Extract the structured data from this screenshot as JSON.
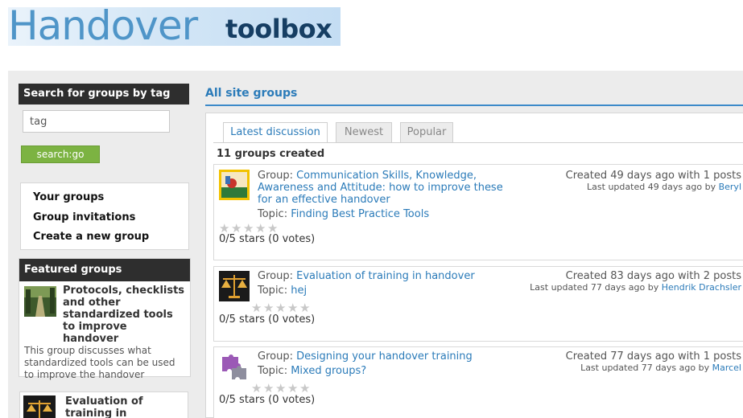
{
  "header": {
    "logo_text_1": "Handover",
    "logo_text_2": "toolbox"
  },
  "sidebar": {
    "search": {
      "title": "Search for groups by tag",
      "value": "tag",
      "button": "search:go"
    },
    "links": [
      "Your groups",
      "Group invitations",
      "Create a new group"
    ],
    "featured": {
      "title": "Featured groups",
      "items": [
        {
          "title": "Protocols, checklists and other standardized tools to improve handover",
          "description": "This group discusses what standardized tools can be used to improve the handover"
        },
        {
          "title": "Evaluation of training in handover"
        }
      ]
    }
  },
  "main": {
    "title": "All site groups",
    "tabs": [
      "Latest discussion",
      "Newest",
      "Popular"
    ],
    "count_text": "11 groups created",
    "group_label": "Group:",
    "topic_label": "Topic:",
    "groups": [
      {
        "name": "Communication Skills, Knowledge, Awareness and Attitude: how to improve these for an effective handover",
        "topic": "Finding Best Practice Tools",
        "created": "Created 49 days ago with 1 posts",
        "updated_prefix": "Last updated 49 days ago by",
        "updated_by": "Beryl",
        "rating": "0/5 stars (0 votes)",
        "icon": "handover-picture-icon"
      },
      {
        "name": "Evaluation of training in handover",
        "topic": "hej",
        "created": "Created 83 days ago with 2 posts",
        "updated_prefix": "Last updated 77 days ago by",
        "updated_by": "Hendrik Drachsler",
        "rating": "0/5 stars (0 votes)",
        "icon": "scales-icon"
      },
      {
        "name": "Designing your handover training",
        "topic": "Mixed groups?",
        "created": "Created 77 days ago with 1 posts",
        "updated_prefix": "Last updated 77 days ago by",
        "updated_by": "Marcel",
        "rating": "0/5 stars (0 votes)",
        "icon": "puzzle-icon"
      }
    ]
  },
  "colors": {
    "accent": "#2b7bb9",
    "button": "#7cb342",
    "header_dark": "#2e2e2e"
  }
}
